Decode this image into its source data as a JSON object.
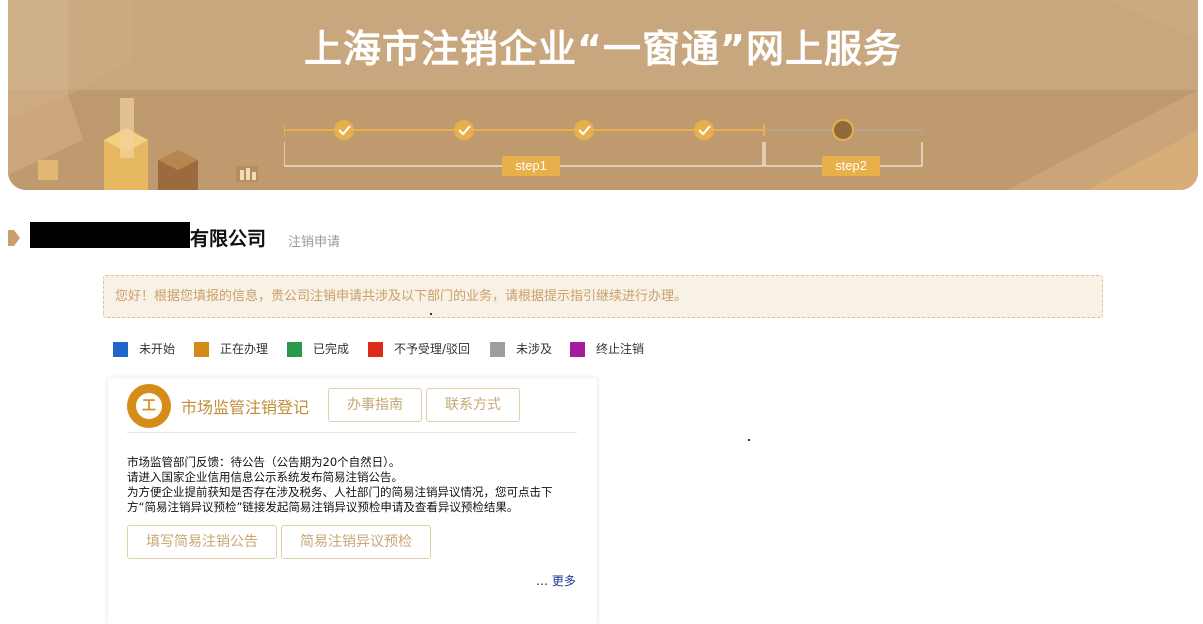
{
  "banner": {
    "title": "上海市注销企业“一窗通”网上服务",
    "steps": [
      {
        "label": "step1"
      },
      {
        "label": "step2"
      }
    ]
  },
  "company": {
    "name_suffix": "有限公司",
    "subtitle": "注销申请"
  },
  "notice": {
    "text": "您好！根据您填报的信息，贵公司注销申请共涉及以下部门的业务，请根据提示指引继续进行办理。"
  },
  "legend": [
    {
      "label": "未开始",
      "color": "#1f66c9"
    },
    {
      "label": "正在办理",
      "color": "#d4891a"
    },
    {
      "label": "已完成",
      "color": "#2a9a4a"
    },
    {
      "label": "不予受理/驳回",
      "color": "#dd2a1b"
    },
    {
      "label": "未涉及",
      "color": "#9e9e9e"
    },
    {
      "label": "终止注销",
      "color": "#a61c9e"
    }
  ],
  "card": {
    "icon_glyph": "工",
    "title": "市场监管注销登记",
    "buttons": {
      "guide": "办事指南",
      "contact": "联系方式",
      "fill_notice": "填写简易注销公告",
      "objection_check": "简易注销异议预检"
    },
    "body_lines": [
      "市场监管部门反馈：待公告（公告期为20个自然日）。",
      "请进入国家企业信用信息公示系统发布简易注销公告。",
      "为方便企业提前获知是否存在涉及税务、人社部门的简易注销异议情况，您可点击下",
      "方“简易注销异议预检”链接发起简易注销异议预检申请及查看异议预检结果。"
    ],
    "more_prefix": "…",
    "more": "更多"
  },
  "colors": {
    "banner": "#c4a178",
    "accent": "#e8b04a",
    "card_title": "#c18c35"
  }
}
